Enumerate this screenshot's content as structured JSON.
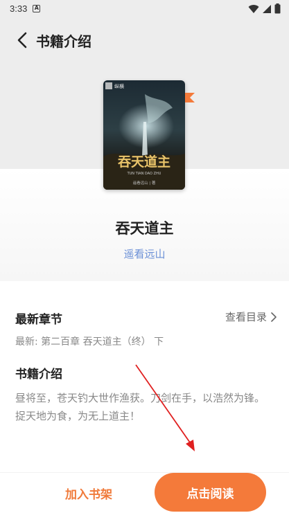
{
  "status_bar": {
    "time": "3:33",
    "notification_glyph": "A"
  },
  "header": {
    "title": "书籍介绍",
    "back_icon": "chevron-left"
  },
  "book": {
    "cover_title": "吞天道主",
    "cover_pinyin": "TUN TIAN DAO ZHU",
    "cover_author": "遥看远山 | 著",
    "cover_publisher": "纵横",
    "title": "吞天道主",
    "author": "遥看远山",
    "accent_color": "#f47a3a"
  },
  "latest": {
    "heading": "最新章节",
    "catalog_link": "查看目录",
    "chapter": "最新: 第二百章 吞天道主（终） 下"
  },
  "intro": {
    "heading": "书籍介绍",
    "text": "昼将至，苍天钓大世作渔获。刀剑在手，以浩然为锋。捉天地为食，为无上道主！"
  },
  "actions": {
    "add_shelf": "加入书架",
    "read": "点击阅读"
  }
}
